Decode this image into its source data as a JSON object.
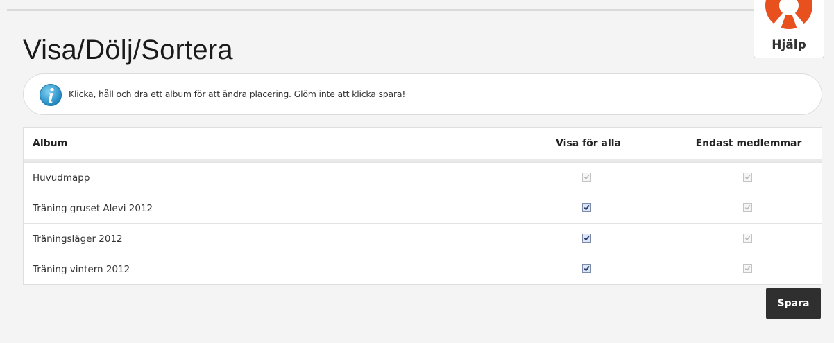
{
  "page": {
    "title": "Visa/Dölj/Sortera"
  },
  "help": {
    "label": "Hjälp",
    "icon": "lifebuoy-icon"
  },
  "info": {
    "icon": "info-icon",
    "text": "Klicka, håll och dra ett album för att ändra placering. Glöm inte att klicka spara!"
  },
  "table": {
    "headers": {
      "album": "Album",
      "visa": "Visa för alla",
      "member": "Endast medlemmar"
    },
    "rows": [
      {
        "label": "Huvudmapp",
        "visa_for_alla": {
          "checked": true,
          "enabled": false
        },
        "endast_medlemmar": {
          "checked": true,
          "enabled": false
        }
      },
      {
        "label": "Träning gruset Alevi 2012",
        "visa_for_alla": {
          "checked": true,
          "enabled": true
        },
        "endast_medlemmar": {
          "checked": true,
          "enabled": false
        }
      },
      {
        "label": "Träningsläger 2012",
        "visa_for_alla": {
          "checked": true,
          "enabled": true
        },
        "endast_medlemmar": {
          "checked": true,
          "enabled": false
        }
      },
      {
        "label": "Träning vintern 2012",
        "visa_for_alla": {
          "checked": true,
          "enabled": true
        },
        "endast_medlemmar": {
          "checked": true,
          "enabled": false
        }
      }
    ]
  },
  "actions": {
    "save_label": "Spara"
  },
  "colors": {
    "background": "#f4f4f4",
    "save_button": "#2f2f2f",
    "lifebuoy_red": "#e8501e",
    "info_blue": "#2a9bd0"
  }
}
